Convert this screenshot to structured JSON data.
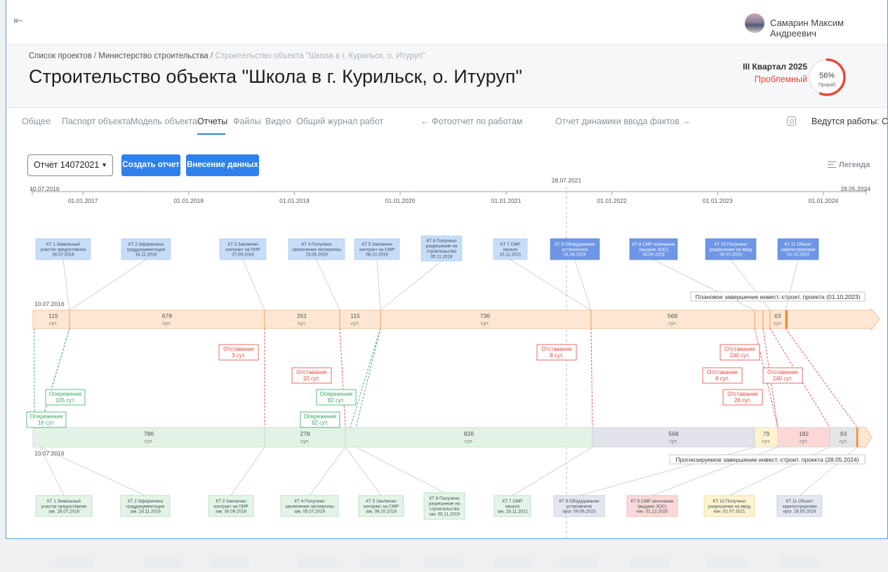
{
  "user": {
    "name": "Самарин Максим Андреевич"
  },
  "breadcrumb": {
    "items": [
      "Список проектов",
      "Министерство строительства"
    ],
    "current": "Строительство объекта \"Школа в г. Курильск, о. Итуруп\"",
    "separator": "/"
  },
  "page_title": "Строительство объекта \"Школа в г. Курильск, о. Итуруп\"",
  "quarter": {
    "label": "III Квартал 2025",
    "status": "Проблемный"
  },
  "progress": {
    "percent": 56,
    "percent_label": "56%",
    "role": "Прораб",
    "color": "#e8473d",
    "track_color": "#eeeeee"
  },
  "tabs": [
    {
      "label": "Общее",
      "active": false
    },
    {
      "label": "Паспорт объекта",
      "active": false
    },
    {
      "label": "Модель объекта",
      "active": false
    },
    {
      "label": "Отчеты",
      "active": true
    },
    {
      "label": "Файлы",
      "active": false
    },
    {
      "label": "Видео",
      "active": false
    },
    {
      "label": "Общий журнал работ",
      "active": false
    }
  ],
  "nav_links": {
    "photo_report": "← Фотоотчет по работам",
    "dynamics_report": "Отчет динамики ввода фактов →"
  },
  "work_status": "Ведутся работы: СМР",
  "toolbar": {
    "report_select": "Отчет 14072021",
    "create_button": "Создать отчет",
    "data_entry_button": "Внесение данных",
    "legend": "Легенда"
  },
  "timeline": {
    "start_date": "10.07.2016",
    "end_date": "28.05.2024",
    "current_date": "28.07.2021",
    "year_ticks": [
      "01.01.2017",
      "01.01.2018",
      "01.01.2019",
      "01.01.2020",
      "01.01.2021",
      "01.01.2022",
      "01.01.2023",
      "01.01.2024"
    ]
  },
  "planned": {
    "start_label": "10.07.2016",
    "segments": [
      {
        "days": "115",
        "unit": "сут."
      },
      {
        "days": "678",
        "unit": "сут."
      },
      {
        "days": "261",
        "unit": "сут."
      },
      {
        "days": "115",
        "unit": "сут."
      },
      {
        "days": "736",
        "unit": "сут."
      },
      {
        "days": "568",
        "unit": "сут."
      },
      {
        "days": "63",
        "unit": "сут."
      }
    ],
    "completion_label": "Плановое завершение инвест.-строит. проекта (01.10.2023)",
    "color": "#fde7d2",
    "border": "#f7b27a"
  },
  "forecast": {
    "start_label": "10.07.2016",
    "segments": [
      {
        "days": "786",
        "unit": "сут.",
        "color": "#e2f2e4"
      },
      {
        "days": "278",
        "unit": "сут.",
        "color": "#e2f2e4"
      },
      {
        "days": "826",
        "unit": "сут.",
        "color": "#e2f2e4"
      },
      {
        "days": "568",
        "unit": "сут.",
        "color": "#e1e2ea"
      },
      {
        "days": "79",
        "unit": "сут.",
        "color": "#fdf3cf"
      },
      {
        "days": "182",
        "unit": "сут.",
        "color": "#fbd8d6"
      },
      {
        "days": "93",
        "unit": "сут.",
        "color": "#e4e5e7"
      }
    ],
    "completion_label": "Прогнозируемое завершение инвест.-строит. проекта (28.05.2024)"
  },
  "plan_milestones": [
    {
      "lines": [
        "КТ 1 Земельный",
        "участок предоставлен",
        "26.07.2016"
      ],
      "style": "light"
    },
    {
      "lines": [
        "КТ 2 Оформлена",
        "граддокументация",
        "18.11.2016"
      ],
      "style": "light"
    },
    {
      "lines": [
        "КТ 3 Заключен",
        "контракт на ПИР",
        "27.09.2018"
      ],
      "style": "light"
    },
    {
      "lines": [
        "КТ 4 Получено",
        "заключение экспертизы",
        "15.06.2019"
      ],
      "style": "light"
    },
    {
      "lines": [
        "КТ 5 Заключен",
        "контракт на СМР",
        "08.10.2019"
      ],
      "style": "light"
    },
    {
      "lines": [
        "КТ 6 Получено",
        "разрешение на",
        "строительство",
        "05.11.2019"
      ],
      "style": "light"
    },
    {
      "lines": [
        "КТ 7 СМР",
        "начало",
        "10.11.2021"
      ],
      "style": "light"
    },
    {
      "lines": [
        "КТ 9 Оборудование",
        "установлено",
        "01.06.2023"
      ],
      "style": "dark"
    },
    {
      "lines": [
        "КТ 8 СМР окончание",
        "(выдано ЗОС)",
        "30.06.2023"
      ],
      "style": "dark"
    },
    {
      "lines": [
        "КТ 10 Получено",
        "разрешение на ввод",
        "30.07.2023"
      ],
      "style": "dark"
    },
    {
      "lines": [
        "КТ 11 Объект",
        "зарегистрирован",
        "01.10.2023"
      ],
      "style": "dark"
    }
  ],
  "fact_milestones": [
    {
      "lines": [
        "КТ 1 Земельный",
        "участок предоставлен",
        "зак. 26.07.2016"
      ],
      "style": "done"
    },
    {
      "lines": [
        "КТ 2 Оформлена",
        "граддокументация",
        "зак. 18.11.2016"
      ],
      "style": "done"
    },
    {
      "lines": [
        "КТ 3 Заключен",
        "контракт на ПИР",
        "зак. 30.09.2018"
      ],
      "style": "done"
    },
    {
      "lines": [
        "КТ 4 Получено",
        "заключение экспертизы",
        "зак. 05.07.2019"
      ],
      "style": "done"
    },
    {
      "lines": [
        "КТ 5 Заключен",
        "контракт на СМР",
        "зак. 08.10.2019"
      ],
      "style": "done"
    },
    {
      "lines": [
        "КТ 6 Получено",
        "разрешение на",
        "строительство",
        "зак. 05.11.2019"
      ],
      "style": "done"
    },
    {
      "lines": [
        "КТ 7 СМР",
        "начало",
        "зак. 18.11.2021"
      ],
      "style": "done"
    },
    {
      "lines": [
        "КТ 9 Оборудование",
        "установлено",
        "прог. 09.06.2023"
      ],
      "style": "forecast"
    },
    {
      "lines": [
        "КТ 8 СМР окончание",
        "(выдано ЗОС)",
        "нач. 01.12.2020"
      ],
      "style": "risk"
    },
    {
      "lines": [
        "КТ 10 Получено",
        "разрешение на ввод",
        "нач. 01.07.2021"
      ],
      "style": "warn"
    },
    {
      "lines": [
        "КТ 11 Объект",
        "зарегистрирован",
        "прог. 28.05.2024"
      ],
      "style": "forecast"
    }
  ],
  "deviations": [
    {
      "kind": "lead",
      "lines": [
        "Опережение",
        "105 сут."
      ]
    },
    {
      "kind": "lead",
      "lines": [
        "Опережение",
        "16 сут."
      ]
    },
    {
      "kind": "lag",
      "lines": [
        "Отставание",
        "3 сут."
      ]
    },
    {
      "kind": "lag",
      "lines": [
        "Отставание",
        "20 сут."
      ]
    },
    {
      "kind": "lead",
      "lines": [
        "Опережение",
        "82 сут."
      ]
    },
    {
      "kind": "lead",
      "lines": [
        "Опережение",
        "92 сут."
      ]
    },
    {
      "kind": "lag",
      "lines": [
        "Отставание",
        "8 сут."
      ]
    },
    {
      "kind": "lag",
      "lines": [
        "Отставание",
        "240 сут."
      ]
    },
    {
      "kind": "lag",
      "lines": [
        "Отставание",
        "8 сут."
      ]
    },
    {
      "kind": "lag",
      "lines": [
        "Отставание",
        "240 сут."
      ]
    },
    {
      "kind": "lag",
      "lines": [
        "Отставание",
        "28 сут."
      ]
    }
  ],
  "colors": {
    "accent": "#2f80ed",
    "lag": "#e8473d",
    "lead": "#3aa661",
    "plan_light": "#c6dcf7",
    "plan_dark": "#6e96e6"
  }
}
